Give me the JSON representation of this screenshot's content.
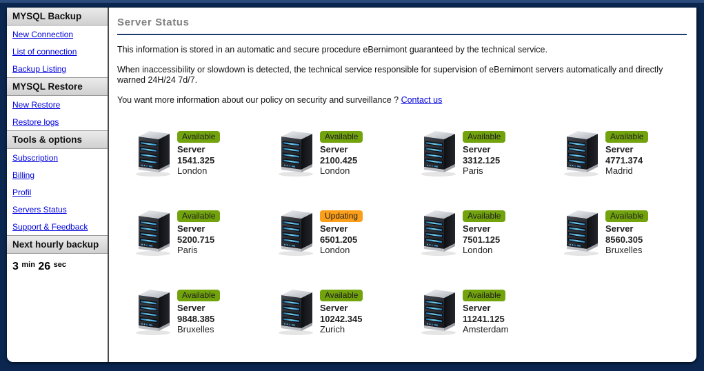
{
  "colors": {
    "page_background": "#0b2750",
    "top_strip": "#2a4b7c",
    "link": "#0000dd",
    "title_text": "#7f7f7f",
    "title_rule": "#1c3c6e",
    "available_badge": "#72a30d",
    "updating_badge": "#fb9e19"
  },
  "sidebar": {
    "sections": [
      {
        "title": "MYSQL Backup",
        "items": [
          "New Connection",
          "List of connection",
          "Backup Listing"
        ]
      },
      {
        "title": "MYSQL Restore",
        "items": [
          "New Restore",
          "Restore logs"
        ]
      },
      {
        "title": "Tools & options",
        "items": [
          "Subscription",
          "Billing",
          "Profil",
          "Servers Status",
          "Support & Feedback"
        ]
      },
      {
        "title": "Next hourly backup",
        "items": []
      }
    ],
    "countdown": {
      "minutes": "3",
      "minutes_unit": "min",
      "seconds": "26",
      "seconds_unit": "sec"
    }
  },
  "main": {
    "title": "Server Status",
    "paragraphs": [
      "This information is stored in an automatic and secure procedure eBernimont guaranteed by the technical service.",
      "When inaccessibility or slowdown is detected, the technical service responsible for supervision of eBernimont servers automatically and directly warned 24H/24 7d/7."
    ],
    "contact_prompt": "You want more information about our policy on security and surveillance ? ",
    "contact_link": "Contact us",
    "status_colors": {
      "Available": "#72a30d",
      "Updating": "#fb9e19"
    },
    "servers": [
      {
        "status": "Available",
        "label": "Server",
        "number": "1541.325",
        "location": "London"
      },
      {
        "status": "Available",
        "label": "Server",
        "number": "2100.425",
        "location": "London"
      },
      {
        "status": "Available",
        "label": "Server",
        "number": "3312.125",
        "location": "Paris"
      },
      {
        "status": "Available",
        "label": "Server",
        "number": "4771.374",
        "location": "Madrid"
      },
      {
        "status": "Available",
        "label": "Server",
        "number": "5200.715",
        "location": "Paris"
      },
      {
        "status": "Updating",
        "label": "Server",
        "number": "6501.205",
        "location": "London"
      },
      {
        "status": "Available",
        "label": "Server",
        "number": "7501.125",
        "location": "London"
      },
      {
        "status": "Available",
        "label": "Server",
        "number": "8560.305",
        "location": "Bruxelles"
      },
      {
        "status": "Available",
        "label": "Server",
        "number": "9848.385",
        "location": "Bruxelles"
      },
      {
        "status": "Available",
        "label": "Server",
        "number": "10242.345",
        "location": "Zurich"
      },
      {
        "status": "Available",
        "label": "Server",
        "number": "11241.125",
        "location": "Amsterdam"
      }
    ]
  }
}
